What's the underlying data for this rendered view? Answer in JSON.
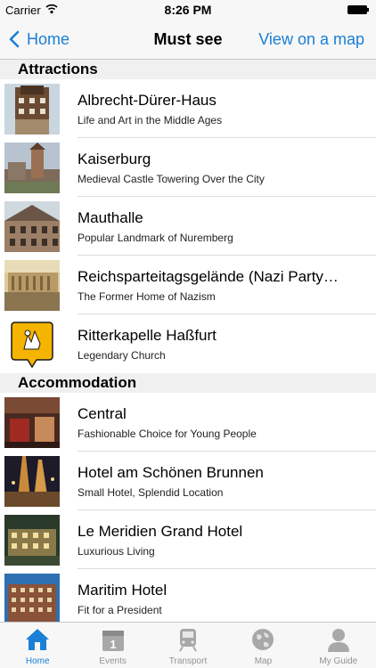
{
  "status_bar": {
    "carrier": "Carrier",
    "time": "8:26 PM"
  },
  "nav": {
    "back_label": "Home",
    "title": "Must see",
    "map_label": "View on a map"
  },
  "sections": [
    {
      "title": "Attractions",
      "items": [
        {
          "title": "Albrecht-Dürer-Haus",
          "subtitle": "Life and Art in the Middle Ages"
        },
        {
          "title": "Kaiserburg",
          "subtitle": "Medieval Castle Towering Over the City"
        },
        {
          "title": "Mauthalle",
          "subtitle": "Popular Landmark of Nuremberg"
        },
        {
          "title": "Reichsparteitagsgelände (Nazi Party…",
          "subtitle": "The Former Home of Nazism"
        },
        {
          "title": "Ritterkapelle Haßfurt",
          "subtitle": "Legendary Church"
        }
      ]
    },
    {
      "title": "Accommodation",
      "items": [
        {
          "title": "Central",
          "subtitle": "Fashionable Choice for Young People"
        },
        {
          "title": "Hotel am Schönen Brunnen",
          "subtitle": "Small Hotel, Splendid Location"
        },
        {
          "title": "Le Meridien Grand Hotel",
          "subtitle": "Luxurious Living"
        },
        {
          "title": "Maritim Hotel",
          "subtitle": "Fit for a President"
        }
      ]
    }
  ],
  "tabs": [
    {
      "label": "Home",
      "icon": "house-icon",
      "active": true
    },
    {
      "label": "Events",
      "icon": "calendar-icon",
      "active": false
    },
    {
      "label": "Transport",
      "icon": "train-icon",
      "active": false
    },
    {
      "label": "Map",
      "icon": "globe-icon",
      "active": false
    },
    {
      "label": "My Guide",
      "icon": "person-icon",
      "active": false
    }
  ],
  "colors": {
    "accent": "#1a7fd6",
    "inactive": "#929292",
    "section_bg": "#f0f0f0"
  }
}
